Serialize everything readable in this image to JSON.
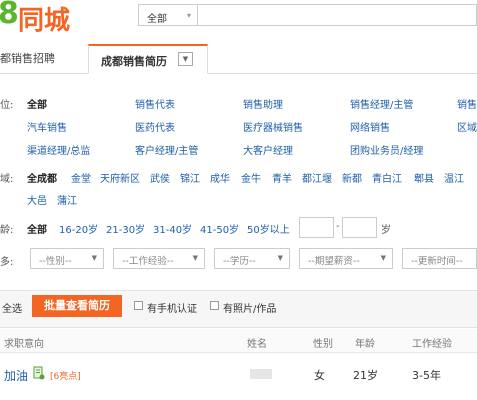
{
  "header": {
    "logo_digit": "8",
    "logo_text": "同城",
    "search_scope": "全部",
    "search_placeholder": ""
  },
  "tabs": [
    {
      "label": "都销售招聘"
    },
    {
      "label": "成都销售简历"
    }
  ],
  "filters": {
    "position": {
      "label": "位:",
      "items": [
        "全部",
        "销售代表",
        "销售助理",
        "销售经理/主管",
        "销售",
        "汽车销售",
        "医药代表",
        "医疗器械销售",
        "网络销售",
        "区域",
        "渠道经理/总监",
        "客户经理/主管",
        "大客户经理",
        "团购业务员/经理"
      ]
    },
    "area": {
      "label": "域:",
      "items": [
        "全成都",
        "金堂",
        "天府新区",
        "武侯",
        "锦江",
        "成华",
        "金牛",
        "青羊",
        "都江堰",
        "新都",
        "青白江",
        "郫县",
        "温江",
        "大邑",
        "蒲江"
      ]
    },
    "age": {
      "label": "龄:",
      "items": [
        "全部",
        "16-20岁",
        "21-30岁",
        "31-40岁",
        "41-50岁",
        "50岁以上"
      ],
      "range_sep": "-",
      "unit": "岁"
    },
    "more": {
      "label": "多:",
      "selects": [
        "--性别--",
        "--工作经验--",
        "--学历--",
        "--期望薪资--",
        "--更新时间--"
      ]
    }
  },
  "list": {
    "select_all": "全选",
    "batch_button": "批量查看简历",
    "check_phone": "有手机认证",
    "check_photo": "有照片/作品",
    "columns": [
      "求职意向",
      "姓名",
      "性别",
      "年龄",
      "工作经验"
    ],
    "rows": [
      {
        "title": "加油",
        "tag": "[6亮点]",
        "name": "",
        "gender": "女",
        "age": "21岁",
        "exp": "3-5年"
      }
    ]
  },
  "colors": {
    "accent": "#f26522",
    "link": "#1f5fa8",
    "logo_green": "#5cb531"
  }
}
